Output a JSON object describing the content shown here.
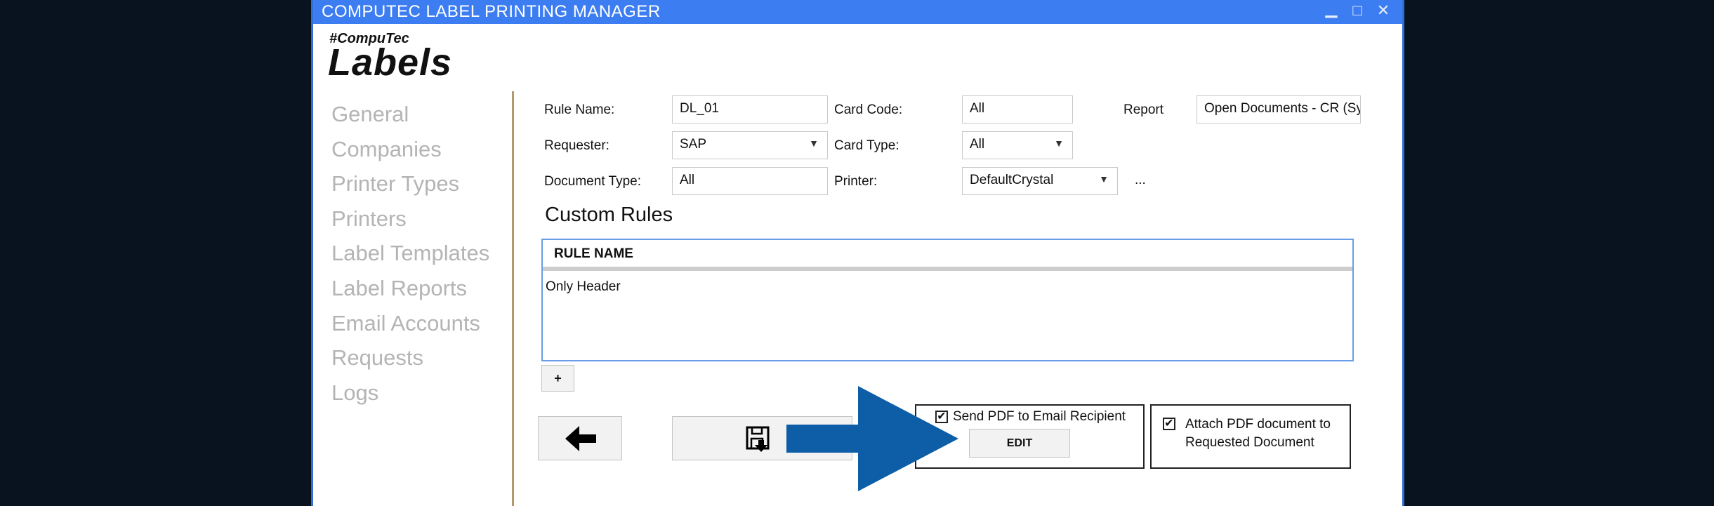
{
  "window": {
    "title": "COMPUTEC LABEL PRINTING MANAGER",
    "minimize_glyph": "▁",
    "maximize_glyph": "□",
    "close_glyph": "✕"
  },
  "logo": {
    "tag": "#CompuTec",
    "name": "Labels"
  },
  "nav": {
    "items": [
      {
        "label": "General"
      },
      {
        "label": "Companies"
      },
      {
        "label": "Printer Types"
      },
      {
        "label": "Printers"
      },
      {
        "label": "Label Templates"
      },
      {
        "label": "Label Reports"
      },
      {
        "label": "Email Accounts"
      },
      {
        "label": "Requests"
      },
      {
        "label": "Logs"
      }
    ]
  },
  "form": {
    "rule_name_label": "Rule Name:",
    "rule_name_value": "DL_01",
    "card_code_label": "Card Code:",
    "card_code_value": "All",
    "report_label": "Report",
    "report_value": "Open Documents - CR (System)",
    "requester_label": "Requester:",
    "requester_value": "SAP",
    "card_type_label": "Card Type:",
    "card_type_value": "All",
    "document_type_label": "Document Type:",
    "document_type_value": "All",
    "printer_label": "Printer:",
    "printer_value": "DefaultCrystal",
    "printer_more": "...",
    "dropdown_glyph": "▼"
  },
  "custom_rules": {
    "title": "Custom Rules",
    "column_header": "RULE NAME",
    "rows": [
      "Only Header"
    ],
    "add_label": "+"
  },
  "actions": {
    "back_icon": "arrow-left-icon",
    "save_icon": "save-icon",
    "send_pdf_label": "Send PDF to Email Recipient",
    "send_pdf_checked": true,
    "edit_label": "EDIT",
    "attach_pdf_label_line1": "Attach PDF document to",
    "attach_pdf_label_line2": "Requested Document",
    "attach_pdf_checked": true,
    "check_glyph": "✔"
  },
  "colors": {
    "titlebar": "#3d7df2",
    "window_border": "#2f6fd8",
    "background": "#09121f",
    "annotation_arrow": "#0d5ea6",
    "nav_text": "#b4b4b4",
    "grid_border": "#6a9de8"
  }
}
